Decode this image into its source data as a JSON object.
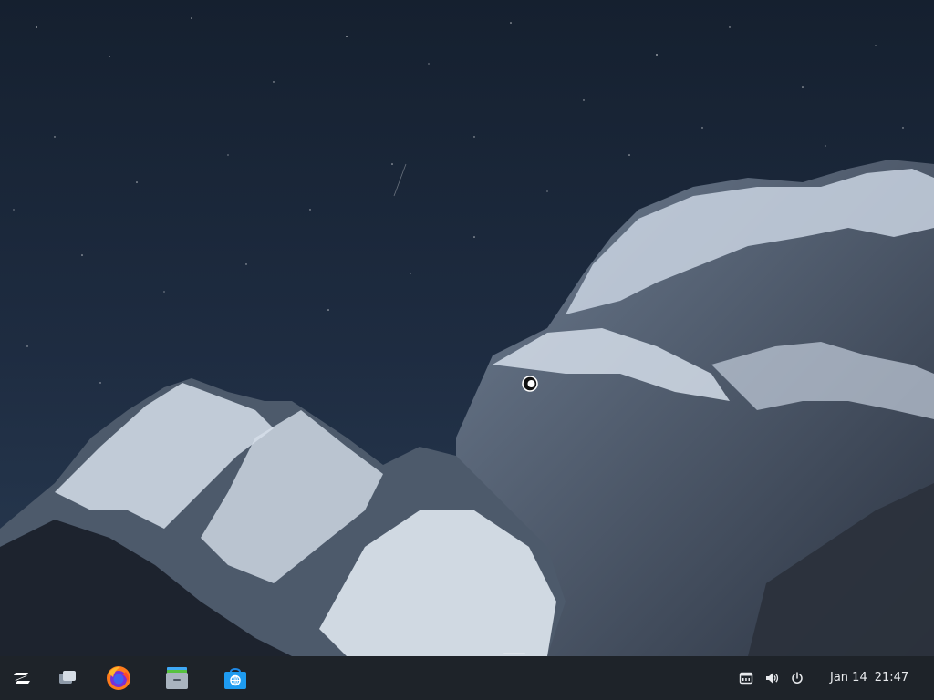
{
  "desktop": {
    "wallpaper": "night-snowy-mountain",
    "sky_color": "#1e2c41",
    "snow_color": "#cfd9e6"
  },
  "taskbar": {
    "background": "#1f2327",
    "items": [
      {
        "name": "zorin-menu-icon"
      },
      {
        "name": "workspaces-icon"
      },
      {
        "name": "firefox-icon"
      },
      {
        "name": "files-icon"
      },
      {
        "name": "software-store-icon"
      }
    ],
    "tray": [
      {
        "name": "network-icon"
      },
      {
        "name": "volume-icon"
      },
      {
        "name": "power-icon"
      }
    ],
    "clock": {
      "date": "Jan 14",
      "time": "21:47"
    }
  }
}
